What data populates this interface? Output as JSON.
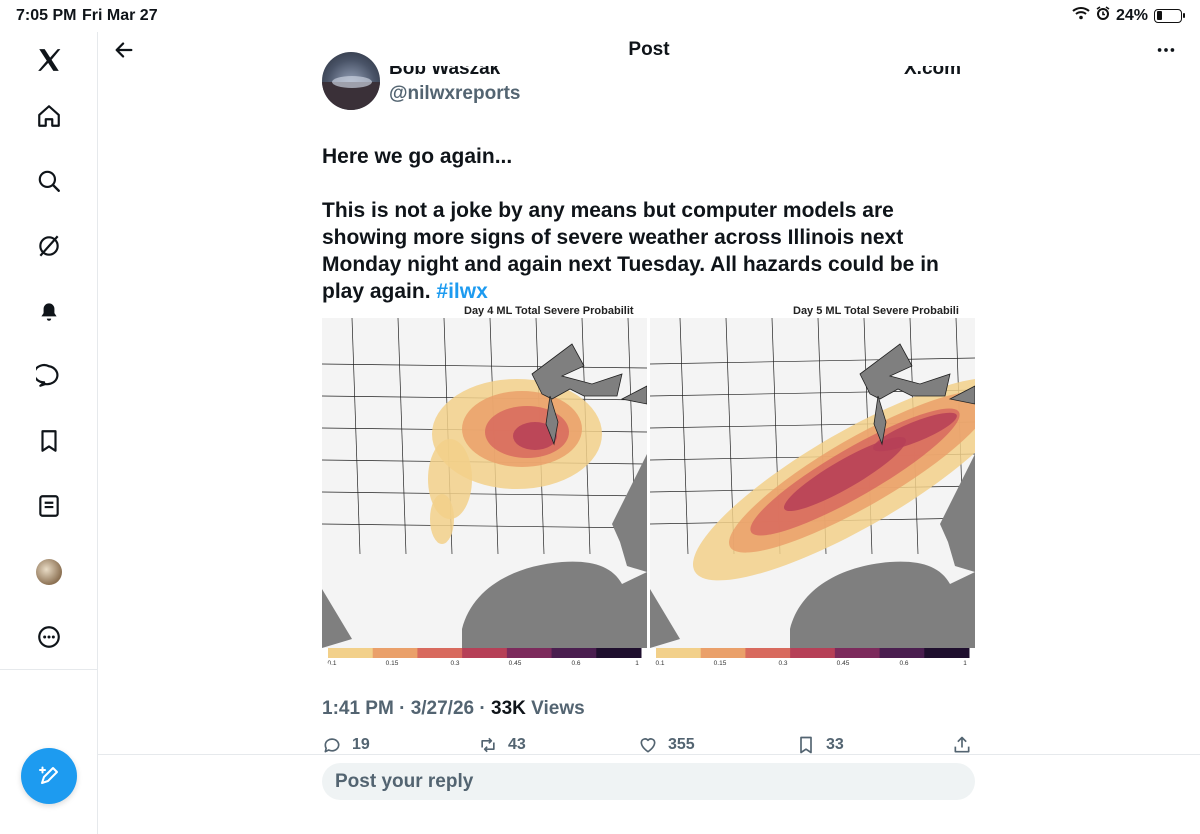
{
  "status_bar": {
    "time": "7:05 PM",
    "date": "Fri Mar 27",
    "battery": "24%",
    "battery_level": 0.24
  },
  "sidebar": {
    "items": [
      {
        "name": "x-logo-icon"
      },
      {
        "name": "home-icon"
      },
      {
        "name": "search-icon"
      },
      {
        "name": "grok-icon"
      },
      {
        "name": "notifications-bell-icon"
      },
      {
        "name": "messages-icon"
      },
      {
        "name": "bookmarks-icon"
      },
      {
        "name": "lists-icon"
      },
      {
        "name": "profile-avatar"
      },
      {
        "name": "more-options-icon"
      }
    ]
  },
  "header": {
    "title": "Post"
  },
  "post": {
    "author_name": "Bob Waszak",
    "handle": "@nilwxreports",
    "source": "X.com",
    "intro": "Here we go again...",
    "body": "This is not a joke by any means but computer models are showing more signs of severe weather across Illinois next Monday night and again next Tuesday. All hazards could be in play again.",
    "hashtag": "#ilwx",
    "time": "1:41 PM",
    "date": "3/27/26",
    "views_count": "33K",
    "views_label": "Views",
    "stats": {
      "replies": "19",
      "reposts": "43",
      "likes": "355",
      "bookmarks": "33"
    }
  },
  "maps": [
    {
      "title": "Day 4 ML Total Severe Probabilit",
      "scale_labels": [
        "0.1",
        "0.15",
        "0.3",
        "0.45",
        "0.6",
        "1"
      ]
    },
    {
      "title": "Day 5 ML Total Severe Probabili",
      "scale_labels": [
        "0.1",
        "0.15",
        "0.3",
        "0.45",
        "0.6",
        "1"
      ]
    }
  ],
  "colors": {
    "accent": "#1d9bf0",
    "scale": [
      "#f2d08a",
      "#eaa06a",
      "#d86a5e",
      "#b64057",
      "#7c2a5c",
      "#4a1e4f",
      "#1f0f2e"
    ],
    "water": "#7f7f7f"
  },
  "reply": {
    "placeholder": "Post your reply"
  }
}
